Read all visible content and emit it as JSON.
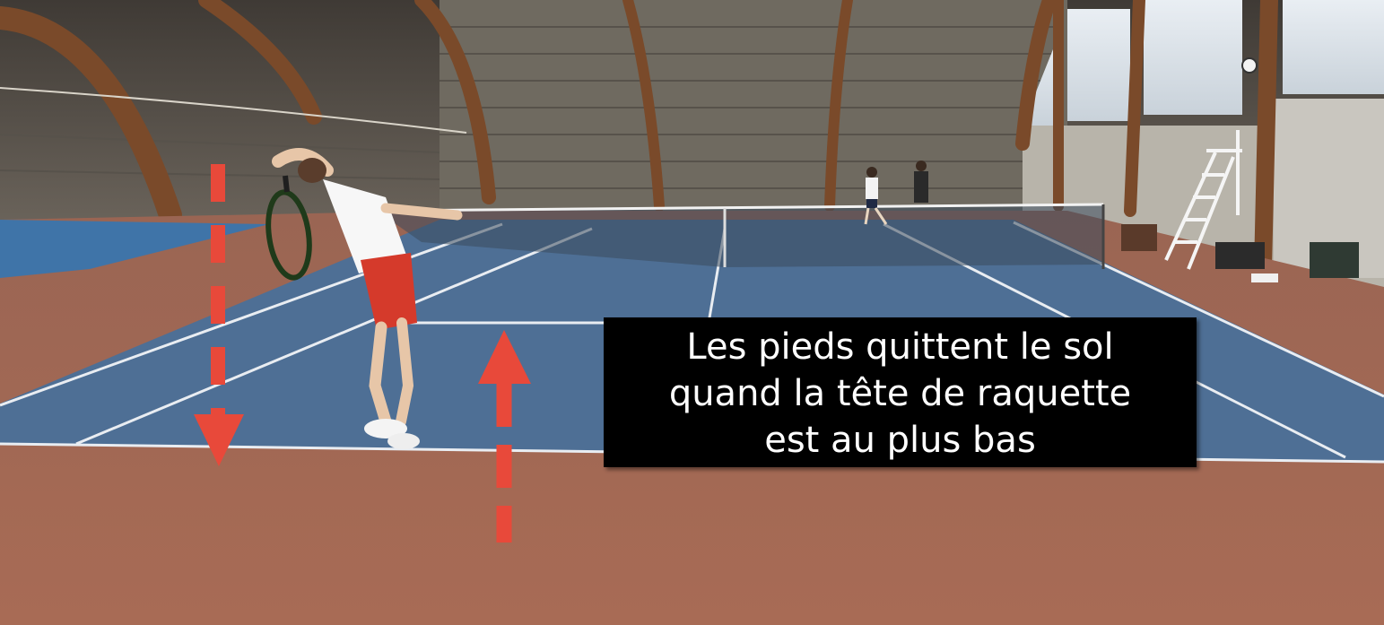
{
  "caption": {
    "lines": [
      "Les pieds quittent le sol",
      "quand la tête de raquette",
      "est au plus bas"
    ]
  },
  "arrows": [
    {
      "name": "down-arrow",
      "direction": "down"
    },
    {
      "name": "up-arrow",
      "direction": "up"
    }
  ],
  "colors": {
    "arrow": "#e8493a",
    "caption_bg": "#000000",
    "caption_text": "#ffffff",
    "court_blue": "#4e6f95",
    "court_clay": "#a96b54"
  }
}
